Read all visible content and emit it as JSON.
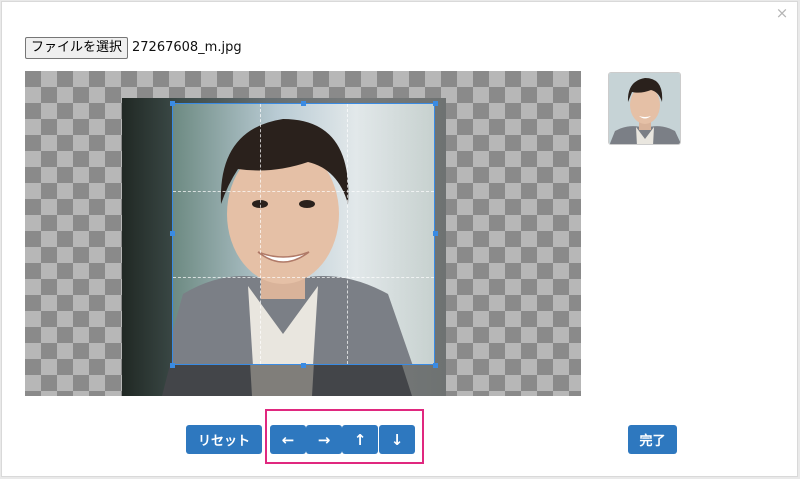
{
  "dialog": {
    "close_glyph": "×"
  },
  "file_input": {
    "button_label": "ファイルを選択",
    "file_name": "27267608_m.jpg"
  },
  "buttons": {
    "reset": "リセット",
    "left": "←",
    "right": "→",
    "up": "↑",
    "down": "↓",
    "done": "完了"
  },
  "colors": {
    "primary_button": "#2e78bf",
    "crop_border": "#3a8be3",
    "highlight": "#e0287f"
  },
  "icons": [
    "close-icon",
    "arrow-left-icon",
    "arrow-right-icon",
    "arrow-up-icon",
    "arrow-down-icon"
  ]
}
